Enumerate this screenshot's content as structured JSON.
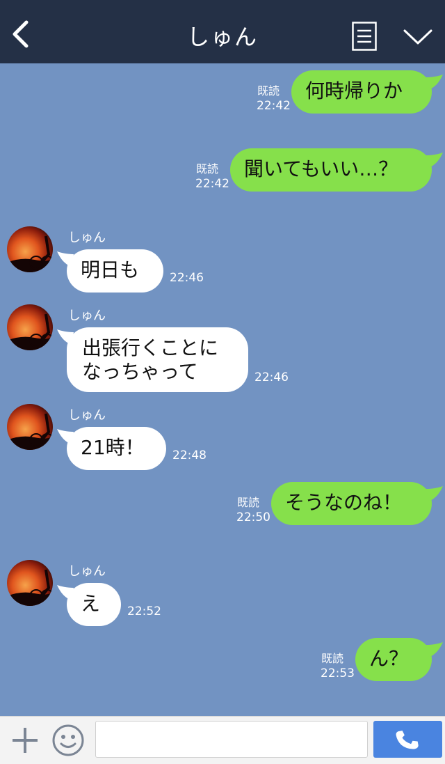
{
  "header": {
    "title": "しゅん",
    "back_icon": "chevron-left-icon",
    "menu_icon": "document-menu-icon",
    "expand_icon": "chevron-down-icon"
  },
  "read_label": "既読",
  "messages": [
    {
      "direction": "out",
      "text": "何時帰りか",
      "read": "既読",
      "time": "22:42"
    },
    {
      "direction": "out",
      "text": "聞いてもいい…？",
      "read": "既読",
      "time": "22:42"
    },
    {
      "direction": "in",
      "sender": "しゅん",
      "text": "明日も",
      "time": "22:46"
    },
    {
      "direction": "in",
      "sender": "しゅん",
      "text_line1": "出張行くことに",
      "text_line2": "なっちゃって",
      "time": "22:46"
    },
    {
      "direction": "in",
      "sender": "しゅん",
      "text": "21時！",
      "time": "22:48"
    },
    {
      "direction": "out",
      "text": "そうなのね！",
      "read": "既読",
      "time": "22:50"
    },
    {
      "direction": "in",
      "sender": "しゅん",
      "text": "え",
      "time": "22:52"
    },
    {
      "direction": "out",
      "text": "ん？",
      "read": "既読",
      "time": "22:53"
    }
  ],
  "footer": {
    "plus_icon": "plus-icon",
    "emoji_icon": "smiley-icon",
    "input_value": "",
    "call_icon": "phone-icon"
  },
  "colors": {
    "header_bg": "#243046",
    "chat_bg": "#7293c2",
    "outgoing_bubble": "#86e04b",
    "incoming_bubble": "#ffffff",
    "call_button": "#4a84e0"
  }
}
